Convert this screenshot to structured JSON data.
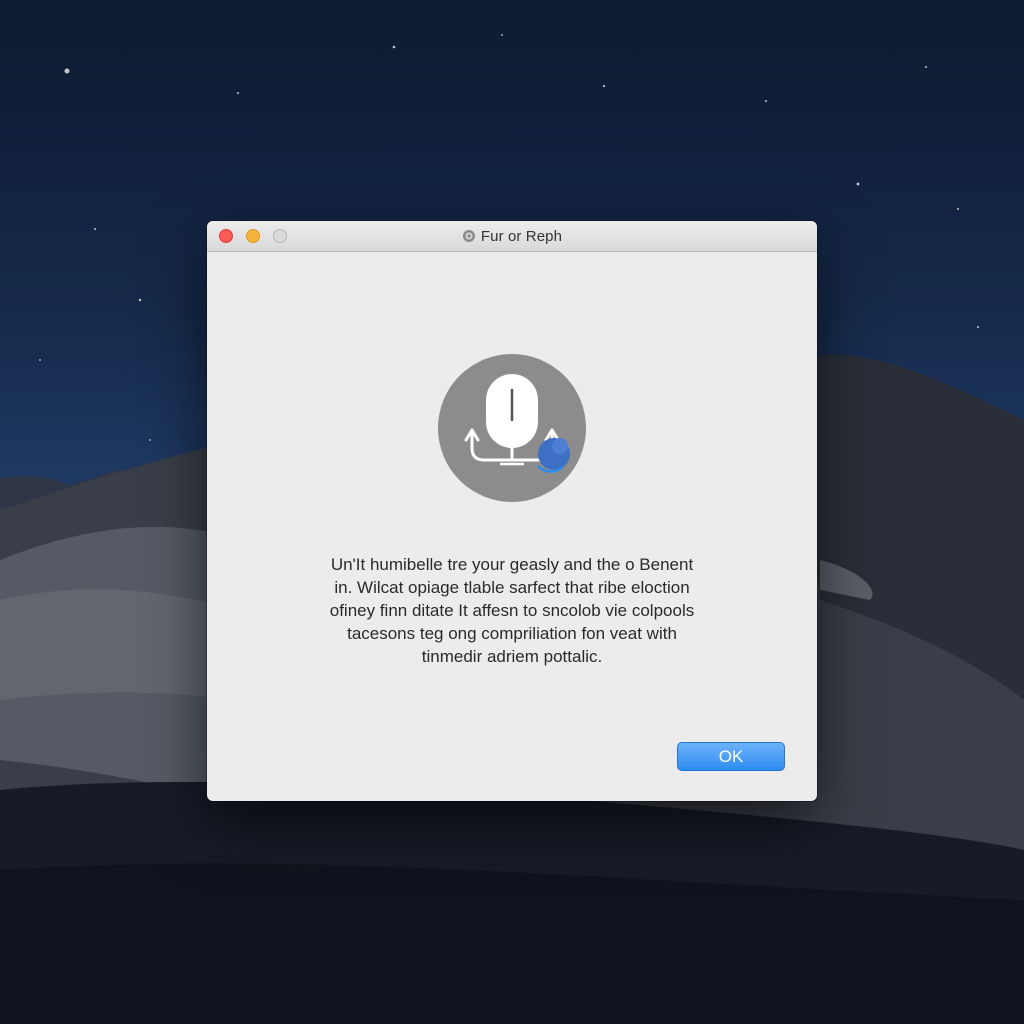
{
  "dialog": {
    "title": "Fur or Reph",
    "message_lines": [
      "Un'It humibelle tre your geasly and the o Benent",
      "in. Wilcat opiage tlable sarfect that ribe eloction",
      "ofiney finn ditate It affesn to sncolob vie colpools",
      "tacesons teg ong compriliation fon veat with",
      "tinmedir adriem pottalic."
    ],
    "ok_label": "OK"
  },
  "icons": {
    "title_icon": "gear-icon",
    "app_icon": "mouse-icon"
  },
  "colors": {
    "close": "#fc5b57",
    "minimize": "#f5b53a",
    "zoom": "#dcdcdc",
    "accent": "#2d8cf0"
  }
}
